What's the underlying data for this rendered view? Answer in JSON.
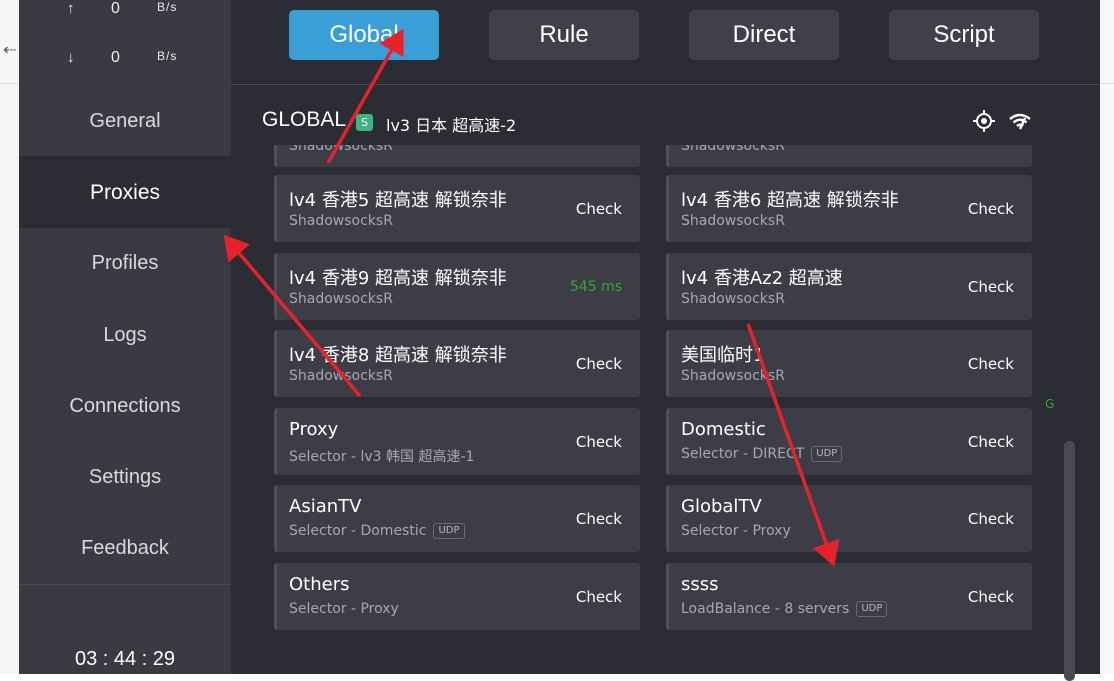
{
  "traffic": {
    "up": {
      "arrow": "↑",
      "value": "0",
      "unit": "B/s"
    },
    "down": {
      "arrow": "↓",
      "value": "0",
      "unit": "B/s"
    }
  },
  "sidebar": {
    "items": [
      {
        "label": "General"
      },
      {
        "label": "Proxies",
        "active": true
      },
      {
        "label": "Profiles"
      },
      {
        "label": "Logs"
      },
      {
        "label": "Connections"
      },
      {
        "label": "Settings"
      },
      {
        "label": "Feedback"
      }
    ],
    "clock": "03 : 44 : 29"
  },
  "modes": [
    {
      "label": "Global",
      "active": true
    },
    {
      "label": "Rule"
    },
    {
      "label": "Direct"
    },
    {
      "label": "Script"
    }
  ],
  "group": {
    "title": "GLOBAL",
    "badge": "S",
    "current": "lv3 日本 超高速-2",
    "icons": [
      "locate-icon",
      "wifi-speedtest-icon"
    ]
  },
  "partial_cards": [
    {
      "type": "ShadowsocksR"
    },
    {
      "type": "ShadowsocksR"
    }
  ],
  "proxies": [
    {
      "name": "lv4 香港5 超高速 解锁奈非",
      "type": "ShadowsocksR",
      "action": "Check"
    },
    {
      "name": "lv4 香港6 超高速 解锁奈非",
      "type": "ShadowsocksR",
      "action": "Check"
    },
    {
      "name": "lv4 香港9 超高速 解锁奈非",
      "type": "ShadowsocksR",
      "delay": "545 ms"
    },
    {
      "name": "lv4 香港Az2 超高速",
      "type": "ShadowsocksR",
      "action": "Check"
    },
    {
      "name": "lv4 香港8 超高速 解锁奈非",
      "type": "ShadowsocksR",
      "action": "Check"
    },
    {
      "name": "美国临时1",
      "type": "ShadowsocksR",
      "action": "Check"
    },
    {
      "name": "Proxy",
      "type": "Selector - lv3 韩国 超高速-1",
      "action": "Check"
    },
    {
      "name": "Domestic",
      "type": "Selector - DIRECT",
      "udp": "UDP",
      "action": "Check"
    },
    {
      "name": "AsianTV",
      "type": "Selector - Domestic",
      "udp": "UDP",
      "action": "Check"
    },
    {
      "name": "GlobalTV",
      "type": "Selector - Proxy",
      "action": "Check"
    },
    {
      "name": "Others",
      "type": "Selector - Proxy",
      "action": "Check"
    },
    {
      "name": "ssss",
      "type": "LoadBalance - 8 servers",
      "udp": "UDP",
      "action": "Check"
    }
  ],
  "scroll_marker": "G",
  "colors": {
    "accent": "#3b9fd7",
    "background": "#2c2c34",
    "sidebar": "#3a3a43",
    "card": "#3d3d47",
    "delay_good": "#2eaa2e",
    "badge": "#3fb27f",
    "annotation": "#e8222a"
  }
}
